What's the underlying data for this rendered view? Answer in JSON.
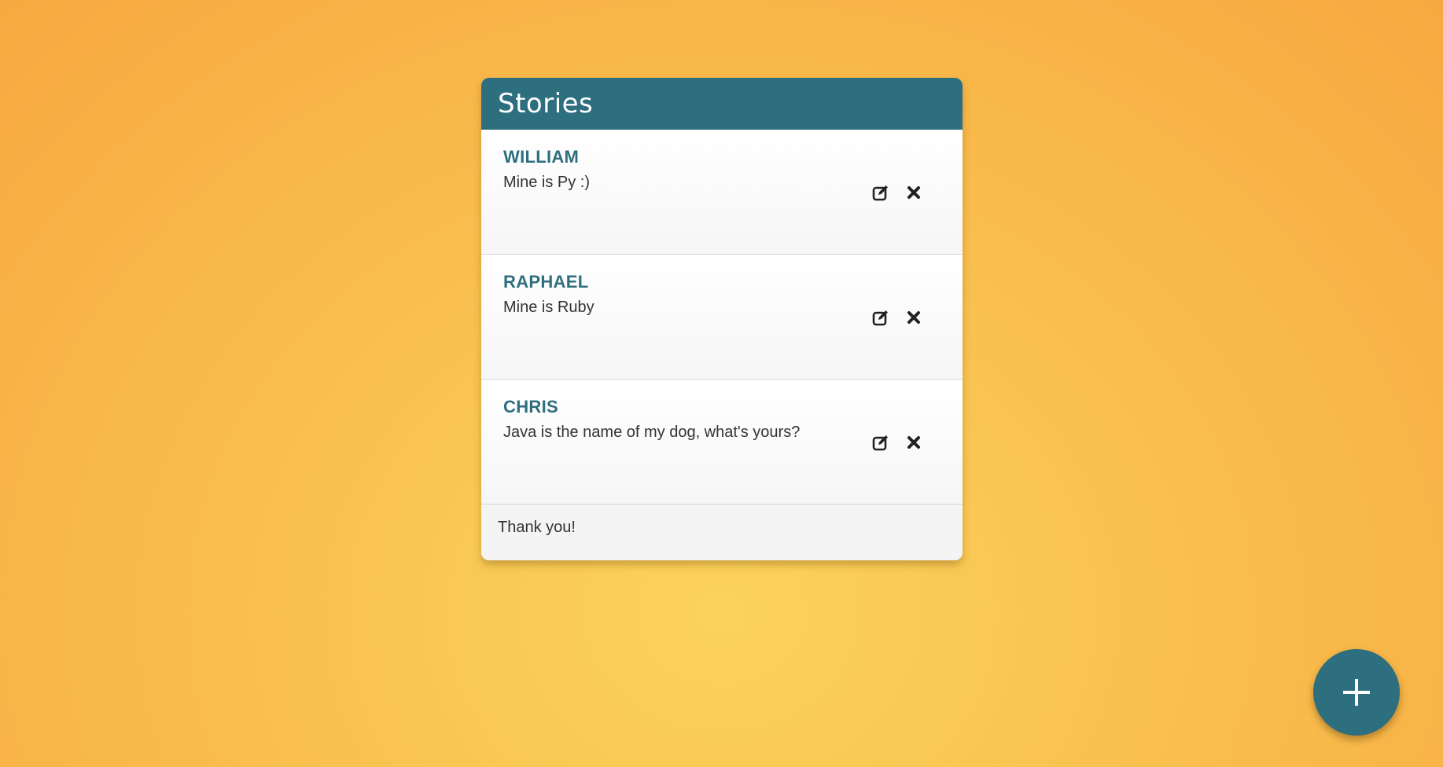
{
  "app": {
    "title": "Stories"
  },
  "stories": [
    {
      "name": "WILLIAM",
      "text": "Mine is Py :)"
    },
    {
      "name": "RAPHAEL",
      "text": "Mine is Ruby"
    },
    {
      "name": "CHRIS",
      "text": "Java is the name of my dog, what's yours?"
    }
  ],
  "footer": {
    "text": "Thank you!"
  },
  "icons": {
    "edit": "edit-icon",
    "delete": "close-icon",
    "add": "plus-icon"
  },
  "colors": {
    "accent": "#2d6f7e",
    "background_light": "#fbd35a",
    "background_dark": "#f8a840"
  }
}
